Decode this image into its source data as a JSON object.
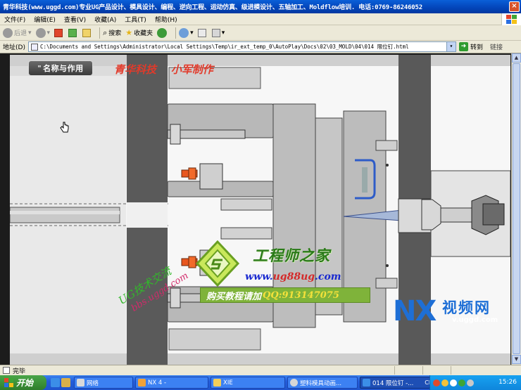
{
  "window": {
    "title": "青华科技(www.uggd.com)专业UG产品设计、模具设计、编程、逆向工程、运动仿真、级进模设计、五轴加工、Moldflow培训. 电话:0769-86246052",
    "close_glyph": "×"
  },
  "menu": [
    "文件(F)",
    "编辑(E)",
    "查看(V)",
    "收藏(A)",
    "工具(T)",
    "帮助(H)"
  ],
  "toolbar": {
    "back_label": "后退",
    "search_label": "搜索",
    "favorites_label": "收藏夹"
  },
  "address": {
    "label": "地址(D)",
    "url": "C:\\Documents and Settings\\Administrator\\Local Settings\\Temp\\ir_ext_temp_0\\AutoPlay\\Docs\\02\\03_MOLD\\04\\014 限位钉.html",
    "go_label": "转到",
    "links_label": "链接"
  },
  "content": {
    "name_button_label": "名称与作用",
    "name_button_glyph": "\"",
    "credit_text": "青华科技    小军制作",
    "watermark_title": "工程师之家",
    "watermark_url_prefix": "www.",
    "watermark_url_mid": "ug88ug",
    "watermark_url_suffix": ".com",
    "watermark_buy_text": "购买教程请加",
    "watermark_qq": "QQ:913147075",
    "watermark_forum": "UG技术交流",
    "watermark_bbs": "bbs.uggd.com",
    "nx_logo_text": "NX",
    "nx_site_cn": "视频网",
    "nx_site_url": "v.uggd.com"
  },
  "status": {
    "text": "完毕"
  },
  "taskbar": {
    "start_label": "开始",
    "tasks": [
      "网络",
      "NX 4 -",
      "XIE",
      "塑料模具动画...",
      "014 限位钉 -..."
    ],
    "lang": "CH",
    "clock": "15:26"
  }
}
